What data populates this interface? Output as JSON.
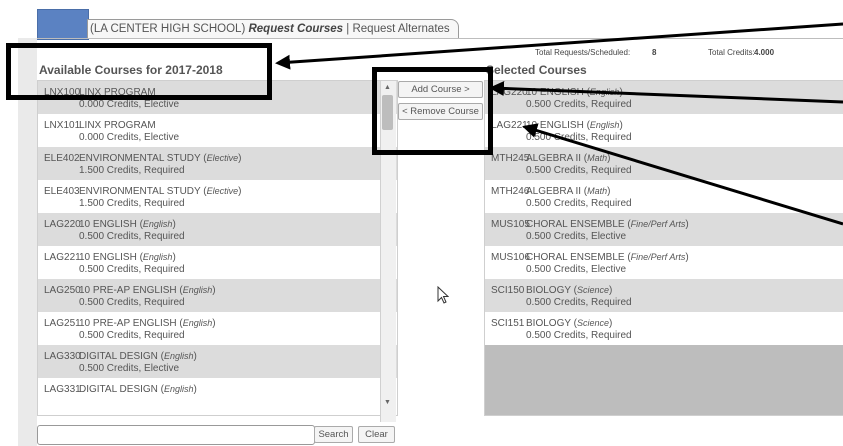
{
  "tabs": {
    "school": "(LA CENTER HIGH SCHOOL)",
    "active": "Request Courses",
    "separator": "|",
    "other": "Request Alternates"
  },
  "summary": {
    "requests_label": "Total Requests/Scheduled:",
    "requests_value": "8",
    "credits_label": "Total Credits:",
    "credits_value": "4.000"
  },
  "available": {
    "heading": "Available Courses for 2017-2018",
    "courses": [
      {
        "code": "LNX100",
        "title": "LINX PROGRAM",
        "category": "",
        "credits": "0.000 Credits,  Elective"
      },
      {
        "code": "LNX101",
        "title": "LINX PROGRAM",
        "category": "",
        "credits": "0.000 Credits,  Elective"
      },
      {
        "code": "ELE402",
        "title": "ENVIRONMENTAL STUDY",
        "category": "Elective",
        "credits": "1.500 Credits,  Required"
      },
      {
        "code": "ELE403",
        "title": "ENVIRONMENTAL STUDY",
        "category": "Elective",
        "credits": "1.500 Credits,  Required"
      },
      {
        "code": "LAG220",
        "title": "10 ENGLISH",
        "category": "English",
        "credits": "0.500 Credits,  Required"
      },
      {
        "code": "LAG221",
        "title": "10 ENGLISH",
        "category": "English",
        "credits": "0.500 Credits,  Required"
      },
      {
        "code": "LAG250",
        "title": "10 PRE-AP ENGLISH",
        "category": "English",
        "credits": "0.500 Credits,  Required"
      },
      {
        "code": "LAG251",
        "title": "10 PRE-AP ENGLISH",
        "category": "English",
        "credits": "0.500 Credits,  Required"
      },
      {
        "code": "LAG330",
        "title": "DIGITAL DESIGN",
        "category": "English",
        "credits": "0.500 Credits,  Elective"
      },
      {
        "code": "LAG331",
        "title": "DIGITAL DESIGN",
        "category": "English",
        "credits": ""
      }
    ]
  },
  "selected": {
    "heading": "Selected Courses",
    "courses": [
      {
        "code": "LAG220",
        "title": "10 ENGLISH",
        "category": "English",
        "credits": "0.500 Credits,  Required"
      },
      {
        "code": "LAG221",
        "title": "10 ENGLISH",
        "category": "English",
        "credits": "0.500 Credits,  Required"
      },
      {
        "code": "MTH245",
        "title": "ALGEBRA II",
        "category": "Math",
        "credits": "0.500 Credits,  Required"
      },
      {
        "code": "MTH246",
        "title": "ALGEBRA II",
        "category": "Math",
        "credits": "0.500 Credits,  Required"
      },
      {
        "code": "MUS105",
        "title": "CHORAL ENSEMBLE",
        "category": "Fine/Perf Arts",
        "credits": "0.500 Credits,  Elective"
      },
      {
        "code": "MUS106",
        "title": "CHORAL ENSEMBLE",
        "category": "Fine/Perf Arts",
        "credits": "0.500 Credits,  Elective"
      },
      {
        "code": "SCI150",
        "title": "BIOLOGY",
        "category": "Science",
        "credits": "0.500 Credits,  Required"
      },
      {
        "code": "SCI151",
        "title": "BIOLOGY",
        "category": "Science",
        "credits": "0.500 Credits,  Required"
      }
    ]
  },
  "buttons": {
    "add": "Add Course >",
    "remove": "< Remove Course",
    "search": "Search",
    "clear": "Clear"
  },
  "search": {
    "value": "",
    "placeholder": ""
  },
  "scroll_arrows": {
    "up": "▲",
    "down": "▼"
  },
  "colors": {
    "tab_accent": "#5b82c2",
    "row_shade": "#dcdcdc",
    "annotation": "#000000"
  }
}
